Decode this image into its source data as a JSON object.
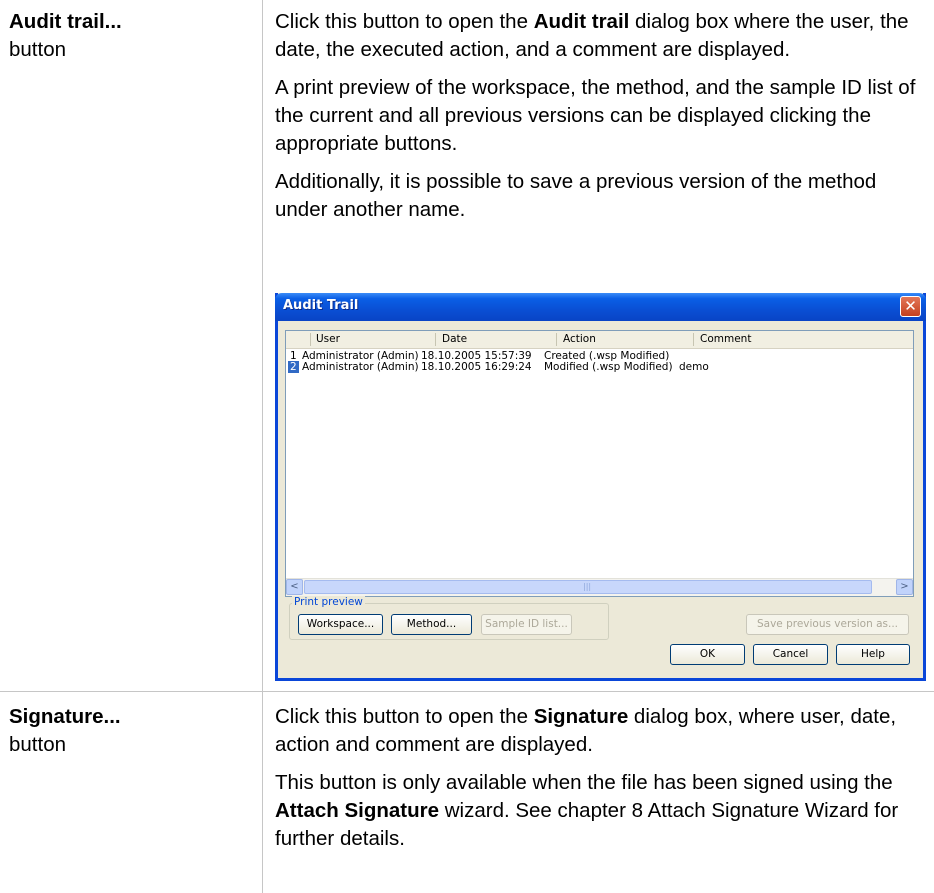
{
  "row1": {
    "label_title": "Audit trail...",
    "label_sub": "button",
    "para1_pre": "Click this button to open the ",
    "para1_bold": "Audit trail",
    "para1_post": " dialog box where the user, the date, the executed action, and a comment are displayed.",
    "para2": "A print preview of the workspace, the method, and the sample ID list of the current and all previous versions can be displayed clicking the appropriate buttons.",
    "para3": "Additionally, it is possible to save a previous version of the method under another name."
  },
  "dialog": {
    "title": "Audit Trail",
    "close_icon": "close-icon",
    "columns": [
      "User",
      "Date",
      "Action",
      "Comment"
    ],
    "rows": [
      {
        "num": "1",
        "user": "Administrator (Admin)",
        "date": "18.10.2005 15:57:39",
        "action": "Created (.wsp Modified)",
        "comment": "",
        "selected": false
      },
      {
        "num": "2",
        "user": "Administrator (Admin)",
        "date": "18.10.2005 16:29:24",
        "action": "Modified (.wsp Modified)",
        "comment": "demo",
        "selected": true
      }
    ],
    "print_preview_label": "Print preview",
    "buttons": {
      "workspace": "Workspace...",
      "method": "Method...",
      "sample_id": "Sample ID list...",
      "save_prev": "Save previous version as...",
      "ok": "OK",
      "cancel": "Cancel",
      "help": "Help"
    },
    "colors": {
      "titlebar": "#0a4fd4",
      "selection": "#316ac5",
      "face": "#ece9d8"
    }
  },
  "row2": {
    "label_title": "Signature...",
    "label_sub": "button",
    "para1_pre": "Click this button to open the ",
    "para1_bold": "Signature",
    "para1_post": " dialog box, where user, date, action and comment are displayed.",
    "para2_pre": "This button is only available when the file has been signed using the ",
    "para2_bold": "Attach Signature",
    "para2_post": " wizard. See chapter 8 Attach Signature Wizard for further details."
  }
}
